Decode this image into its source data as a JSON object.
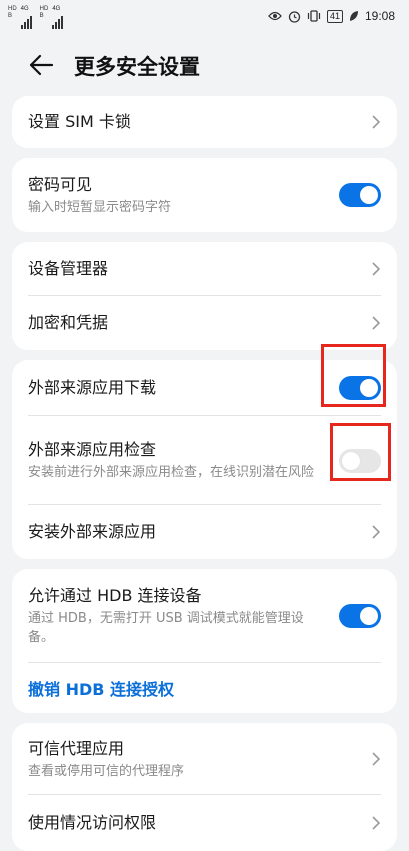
{
  "status_bar": {
    "sim1": [
      "HD",
      "B"
    ],
    "sim2": [
      "HD",
      "B"
    ],
    "net1": "4G",
    "net2": "4G",
    "battery": "41",
    "time": "19:08"
  },
  "header": {
    "title": "更多安全设置"
  },
  "items": {
    "sim_lock": {
      "label": "设置 SIM 卡锁"
    },
    "password_visible": {
      "label": "密码可见",
      "sub": "输入时短暂显示密码字符",
      "state": true
    },
    "device_admin": {
      "label": "设备管理器"
    },
    "encryption": {
      "label": "加密和凭据"
    },
    "external_download": {
      "label": "外部来源应用下载",
      "state": true
    },
    "external_check": {
      "label": "外部来源应用检查",
      "sub": "安装前进行外部来源应用检查，在线识别潜在风险",
      "state": false
    },
    "install_external": {
      "label": "安装外部来源应用"
    },
    "hdb_allow": {
      "label": "允许通过 HDB 连接设备",
      "sub": "通过 HDB，无需打开 USB 调试模式就能管理设备。",
      "state": true
    },
    "hdb_revoke": {
      "label": "撤销 HDB 连接授权"
    },
    "trust_agent": {
      "label": "可信代理应用",
      "sub": "查看或停用可信的代理程序"
    },
    "usage_access": {
      "label": "使用情况访问权限"
    }
  },
  "colors": {
    "accent": "#0a74e6",
    "highlight": "#e6271d"
  }
}
